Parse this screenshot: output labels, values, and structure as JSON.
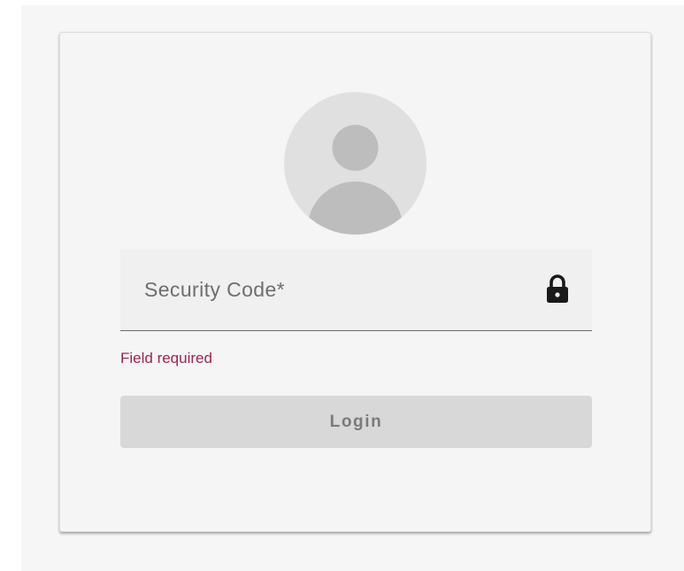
{
  "colors": {
    "card_background": "#f5f5f5",
    "error": "#a0234e",
    "button_disabled_background": "#d8d8d8",
    "button_disabled_text": "#7a7a7a",
    "avatar_background": "#e0e0e0",
    "avatar_figure": "#bdbdbd"
  },
  "login_form": {
    "avatar_icon": "account-circle-icon",
    "security_code": {
      "placeholder": "Security Code*",
      "value": "",
      "icon": "lock-icon",
      "error": "Field required"
    },
    "login_button": {
      "label": "Login",
      "disabled": true
    }
  }
}
